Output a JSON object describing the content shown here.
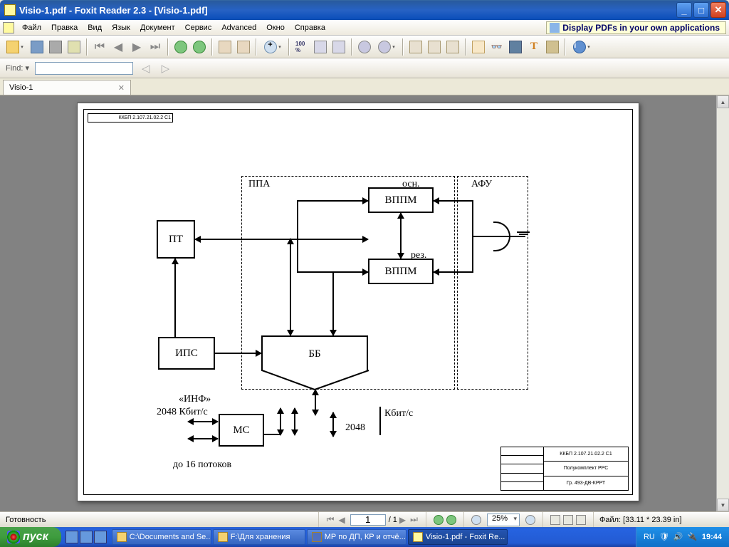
{
  "title": "Visio-1.pdf - Foxit Reader 2.3 - [Visio-1.pdf]",
  "menu": [
    "Файл",
    "Правка",
    "Вид",
    "Язык",
    "Документ",
    "Сервис",
    "Advanced",
    "Окно",
    "Справка"
  ],
  "promo": "Display PDFs in your own applications",
  "find": {
    "label": "Find:",
    "value": ""
  },
  "tab": {
    "name": "Visio-1"
  },
  "diagram": {
    "ppa": "ППА",
    "osn": "осн.",
    "rez": "рез.",
    "afu": "АФУ",
    "pt": "ПТ",
    "vppm1": "ВППМ",
    "vppm2": "ВППМ",
    "ips": "ИПС",
    "bb": "ББ",
    "mc": "МС",
    "inf": "«ИНФ»",
    "rate": "2048 Кбит/с",
    "rate2a": "2048",
    "rate2b": "Кбит/с",
    "flows": "до 16 потоков"
  },
  "titleblock": {
    "a": "ККБП 2.107.21.02.2 С1",
    "b": "Полукомплект РРС",
    "c": "Гр. 493-ДВ-КРРТ"
  },
  "status": {
    "ready": "Готовность",
    "page": "1",
    "pages_total": "/ 1",
    "zoom": "25%",
    "size_label": "Файл:",
    "size": "[33.11 * 23.39 in]"
  },
  "taskbar": {
    "start": "пуск",
    "items": [
      "C:\\Documents and Se...",
      "F:\\Для хранения",
      "МР по ДП, КР и отчё...",
      "Visio-1.pdf - Foxit Re..."
    ],
    "lang": "RU",
    "clock": "19:44"
  }
}
